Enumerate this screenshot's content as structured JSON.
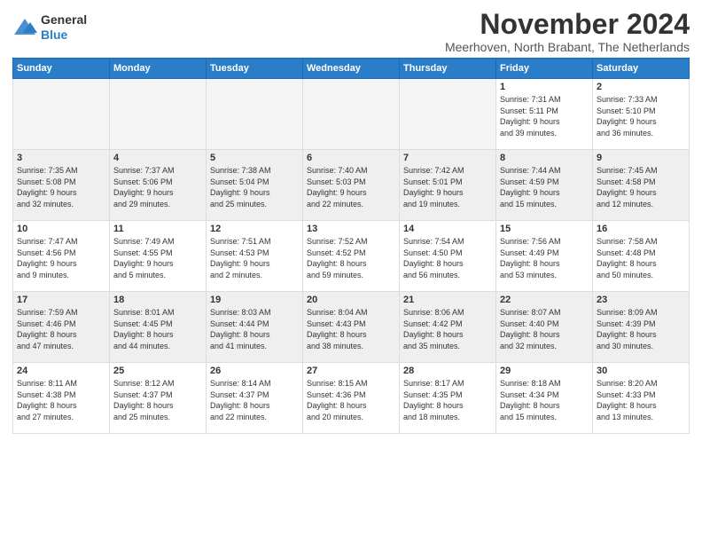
{
  "logo": {
    "general": "General",
    "blue": "Blue"
  },
  "title": "November 2024",
  "subtitle": "Meerhoven, North Brabant, The Netherlands",
  "days_of_week": [
    "Sunday",
    "Monday",
    "Tuesday",
    "Wednesday",
    "Thursday",
    "Friday",
    "Saturday"
  ],
  "weeks": [
    [
      {
        "day": "",
        "info": "",
        "empty": true
      },
      {
        "day": "",
        "info": "",
        "empty": true
      },
      {
        "day": "",
        "info": "",
        "empty": true
      },
      {
        "day": "",
        "info": "",
        "empty": true
      },
      {
        "day": "",
        "info": "",
        "empty": true
      },
      {
        "day": "1",
        "info": "Sunrise: 7:31 AM\nSunset: 5:11 PM\nDaylight: 9 hours\nand 39 minutes."
      },
      {
        "day": "2",
        "info": "Sunrise: 7:33 AM\nSunset: 5:10 PM\nDaylight: 9 hours\nand 36 minutes."
      }
    ],
    [
      {
        "day": "3",
        "info": "Sunrise: 7:35 AM\nSunset: 5:08 PM\nDaylight: 9 hours\nand 32 minutes."
      },
      {
        "day": "4",
        "info": "Sunrise: 7:37 AM\nSunset: 5:06 PM\nDaylight: 9 hours\nand 29 minutes."
      },
      {
        "day": "5",
        "info": "Sunrise: 7:38 AM\nSunset: 5:04 PM\nDaylight: 9 hours\nand 25 minutes."
      },
      {
        "day": "6",
        "info": "Sunrise: 7:40 AM\nSunset: 5:03 PM\nDaylight: 9 hours\nand 22 minutes."
      },
      {
        "day": "7",
        "info": "Sunrise: 7:42 AM\nSunset: 5:01 PM\nDaylight: 9 hours\nand 19 minutes."
      },
      {
        "day": "8",
        "info": "Sunrise: 7:44 AM\nSunset: 4:59 PM\nDaylight: 9 hours\nand 15 minutes."
      },
      {
        "day": "9",
        "info": "Sunrise: 7:45 AM\nSunset: 4:58 PM\nDaylight: 9 hours\nand 12 minutes."
      }
    ],
    [
      {
        "day": "10",
        "info": "Sunrise: 7:47 AM\nSunset: 4:56 PM\nDaylight: 9 hours\nand 9 minutes."
      },
      {
        "day": "11",
        "info": "Sunrise: 7:49 AM\nSunset: 4:55 PM\nDaylight: 9 hours\nand 5 minutes."
      },
      {
        "day": "12",
        "info": "Sunrise: 7:51 AM\nSunset: 4:53 PM\nDaylight: 9 hours\nand 2 minutes."
      },
      {
        "day": "13",
        "info": "Sunrise: 7:52 AM\nSunset: 4:52 PM\nDaylight: 8 hours\nand 59 minutes."
      },
      {
        "day": "14",
        "info": "Sunrise: 7:54 AM\nSunset: 4:50 PM\nDaylight: 8 hours\nand 56 minutes."
      },
      {
        "day": "15",
        "info": "Sunrise: 7:56 AM\nSunset: 4:49 PM\nDaylight: 8 hours\nand 53 minutes."
      },
      {
        "day": "16",
        "info": "Sunrise: 7:58 AM\nSunset: 4:48 PM\nDaylight: 8 hours\nand 50 minutes."
      }
    ],
    [
      {
        "day": "17",
        "info": "Sunrise: 7:59 AM\nSunset: 4:46 PM\nDaylight: 8 hours\nand 47 minutes."
      },
      {
        "day": "18",
        "info": "Sunrise: 8:01 AM\nSunset: 4:45 PM\nDaylight: 8 hours\nand 44 minutes."
      },
      {
        "day": "19",
        "info": "Sunrise: 8:03 AM\nSunset: 4:44 PM\nDaylight: 8 hours\nand 41 minutes."
      },
      {
        "day": "20",
        "info": "Sunrise: 8:04 AM\nSunset: 4:43 PM\nDaylight: 8 hours\nand 38 minutes."
      },
      {
        "day": "21",
        "info": "Sunrise: 8:06 AM\nSunset: 4:42 PM\nDaylight: 8 hours\nand 35 minutes."
      },
      {
        "day": "22",
        "info": "Sunrise: 8:07 AM\nSunset: 4:40 PM\nDaylight: 8 hours\nand 32 minutes."
      },
      {
        "day": "23",
        "info": "Sunrise: 8:09 AM\nSunset: 4:39 PM\nDaylight: 8 hours\nand 30 minutes."
      }
    ],
    [
      {
        "day": "24",
        "info": "Sunrise: 8:11 AM\nSunset: 4:38 PM\nDaylight: 8 hours\nand 27 minutes."
      },
      {
        "day": "25",
        "info": "Sunrise: 8:12 AM\nSunset: 4:37 PM\nDaylight: 8 hours\nand 25 minutes."
      },
      {
        "day": "26",
        "info": "Sunrise: 8:14 AM\nSunset: 4:37 PM\nDaylight: 8 hours\nand 22 minutes."
      },
      {
        "day": "27",
        "info": "Sunrise: 8:15 AM\nSunset: 4:36 PM\nDaylight: 8 hours\nand 20 minutes."
      },
      {
        "day": "28",
        "info": "Sunrise: 8:17 AM\nSunset: 4:35 PM\nDaylight: 8 hours\nand 18 minutes."
      },
      {
        "day": "29",
        "info": "Sunrise: 8:18 AM\nSunset: 4:34 PM\nDaylight: 8 hours\nand 15 minutes."
      },
      {
        "day": "30",
        "info": "Sunrise: 8:20 AM\nSunset: 4:33 PM\nDaylight: 8 hours\nand 13 minutes."
      }
    ]
  ]
}
